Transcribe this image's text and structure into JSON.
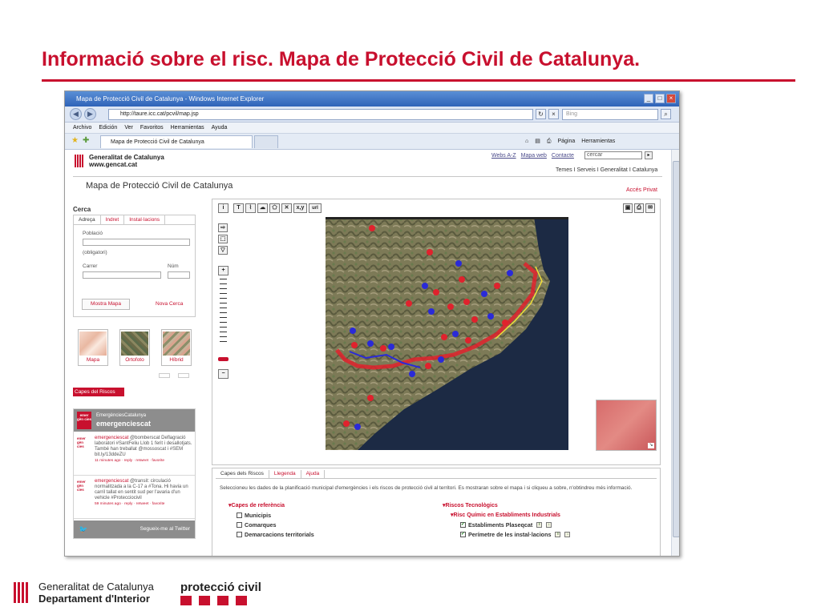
{
  "slide": {
    "title": "Informació sobre el risc. Mapa de Protecció Civil de Catalunya.",
    "accent_color": "#c8102e"
  },
  "browser": {
    "window_title": "Mapa de Protecció Civil de Catalunya - Windows Internet Explorer",
    "url": "http://taure.icc.cat/pcvil/map.jsp",
    "search_placeholder": "Bing",
    "menu": [
      "Archivo",
      "Edición",
      "Ver",
      "Favoritos",
      "Herramientas",
      "Ayuda"
    ],
    "tab_title": "Mapa de Protecció Civil de Catalunya",
    "commands": [
      "Página",
      "Herramientas"
    ]
  },
  "site": {
    "brand_line1": "Generalitat de Catalunya",
    "brand_line2": "www.gencat.cat",
    "top_links": [
      "Webs A-Z",
      "Mapa web",
      "Contacte"
    ],
    "search_box": "cercar",
    "sub_links": "Temes I Serveis I Generalitat I Catalunya",
    "page_heading": "Mapa de Protecció Civil de Catalunya",
    "private_access": "Accés Privat"
  },
  "search": {
    "title": "Cerca",
    "tabs": [
      "Adreça",
      "Indret",
      "Instal·lacions"
    ],
    "poblacio_label": "Població",
    "obligatori": "(obligatori)",
    "carrer_label": "Carrer",
    "num_label": "Núm",
    "show_button": "Mostra Mapa",
    "new_search": "Nova Cerca"
  },
  "map_types": [
    {
      "label": "Mapa"
    },
    {
      "label": "Ortofoto"
    },
    {
      "label": "Híbrid"
    }
  ],
  "capes_label": "Capes del Riscos",
  "twitter": {
    "header_small": "EmergènciesCatalunya",
    "handle": "emergenciescat",
    "logo_text": "emer gèn cies",
    "tweets": [
      {
        "who": "emergenciescat",
        "text": "@bomberscat Deflagració laboratori #SantFeliu Llob 1 ferit i desallotjats. També han treballat @mossoscat i #SEM bit.ly/13ddeZU",
        "meta": "11 minutes ago · reply · retweet · favorite"
      },
      {
        "who": "emergenciescat",
        "text": "@transit: circulació normalitzada a la C-17 a #Tona. Hi havia un carril tallat en sentit sud per l'avaria d'un vehicle #Protecciocivil",
        "meta": "59 minutes ago · reply · retweet · favorite"
      }
    ],
    "follow": "Segueix-me al Twitter"
  },
  "map_toolbar": [
    "T",
    "x,y",
    "url"
  ],
  "legend": {
    "tabs": [
      "Capes dels Riscos",
      "Llegenda",
      "Ajuda"
    ],
    "description": "Seleccioneu les dades de la planificació municipal d'emergències i els riscos de protecció civil al territori. Es mostraran sobre el mapa i si cliqueu a sobre, n'obtindreu més informació.",
    "left_group": "Capes de referència",
    "left_items": [
      {
        "label": "Municipis",
        "checked": false
      },
      {
        "label": "Comarques",
        "checked": false
      },
      {
        "label": "Demarcacions territorials",
        "checked": false
      }
    ],
    "right_group": "Riscos Tecnològics",
    "right_subgroup": "Risc Químic en Establiments Industrials",
    "right_items": [
      {
        "label": "Establiments Plaseqcat",
        "checked": true
      },
      {
        "label": "Perímetre de les instal·lacions",
        "checked": true
      }
    ]
  },
  "footer": {
    "org_line1": "Generalitat de Catalunya",
    "org_line2": "Departament d'Interior",
    "brand": "protecció civil"
  },
  "colors": {
    "hazard_red": "#e0222d",
    "hazard_blue": "#2a2ad8",
    "sea": "#1c2a44",
    "route_yellow": "#f1e03a"
  }
}
